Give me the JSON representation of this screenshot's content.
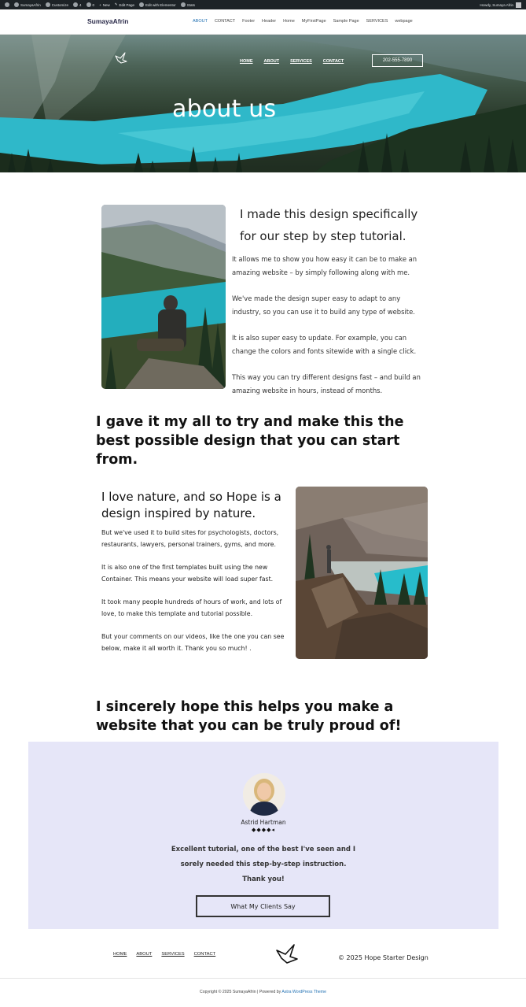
{
  "admin_bar": {
    "site": "SumayaAfrin",
    "customize": "Customize",
    "updates": "4",
    "comments": "0",
    "new": "New",
    "edit_page": "Edit Page",
    "elementor": "Edit with Elementor",
    "stats": "Stats",
    "howdy": "Howdy, Sumaya Afrin"
  },
  "header": {
    "brand": "SumayaAfrin",
    "nav": [
      "ABOUT",
      "CONTACT",
      "Footer",
      "Header",
      "Home",
      "MyFirstPage",
      "Sample Page",
      "SERVICES",
      "webpage"
    ]
  },
  "hero": {
    "nav": [
      "HOME",
      "ABOUT",
      "SERVICES",
      "CONTACT"
    ],
    "phone": "202-555-7890",
    "title": "about us"
  },
  "section1": {
    "heading": "I made this design specifically for our step by step tutorial.",
    "paragraphs": [
      "It allows me to show you how easy it can be to make an amazing website – by simply following along with me.",
      "We've made the design super easy to adapt to any industry, so you can use it to build any type of website.",
      "It is also super easy to update. For example, you can change the colors and fonts sitewide with a single click.",
      "This way you can try different designs fast – and build an amazing website in hours, instead of months."
    ]
  },
  "statement1": "I gave it my all to try and make this the best possible design that you can start from.",
  "section2": {
    "heading": "I love nature, and so Hope is a design inspired by nature.",
    "paragraphs": [
      "But we've used it to build sites for psychologists, doctors, restaurants, lawyers, personal trainers, gyms, and more.",
      "It is also one of the first templates built using the new Container. This means your website will load super fast.",
      "It took many people hundreds of hours of work, and lots of love, to make this template and tutorial possible.",
      "But your comments on our videos, like the one you can see below, make it all worth it. Thank you so much! ."
    ]
  },
  "statement2": "I sincerely hope this helps you make a website that you can be truly proud of!",
  "testimonial": {
    "name": "Astrid Hartman",
    "rating": 4.5,
    "stars": "◆◆◆◆◂",
    "quote": "Excellent tutorial, one of the best I've seen and I sorely needed this step-by-step instruction. Thank you!",
    "button": "What My Clients Say"
  },
  "footer": {
    "nav": [
      "HOME",
      "ABOUT",
      "SERVICES",
      "CONTACT"
    ],
    "copyright": "© 2025 Hope Starter Design",
    "credits_prefix": "Copyright © 2025 SumayaAfrin | Powered by ",
    "credits_link": "Astra WordPress Theme"
  },
  "colors": {
    "admin_bar": "#1d2327",
    "accent_link": "#1f6fb2",
    "testimonial_bg": "#e6e6f8",
    "lake": "#2fb8c9"
  },
  "icons": [
    "wordpress-icon",
    "home-icon",
    "palette-icon",
    "refresh-icon",
    "comment-icon",
    "plus-icon",
    "edit-icon",
    "elementor-icon",
    "stats-icon",
    "avatar-icon",
    "bird-logo-icon"
  ]
}
